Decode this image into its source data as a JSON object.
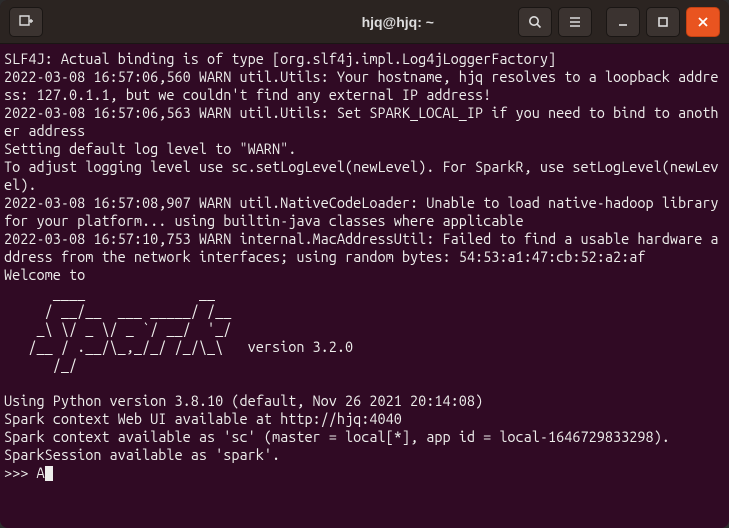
{
  "titlebar": {
    "title": "hjq@hjq: ~"
  },
  "terminal": {
    "lines": [
      "SLF4J: Actual binding is of type [org.slf4j.impl.Log4jLoggerFactory]",
      "2022-03-08 16:57:06,560 WARN util.Utils: Your hostname, hjq resolves to a loopback address: 127.0.1.1, but we couldn't find any external IP address!",
      "2022-03-08 16:57:06,563 WARN util.Utils: Set SPARK_LOCAL_IP if you need to bind to another address",
      "Setting default log level to \"WARN\".",
      "To adjust logging level use sc.setLogLevel(newLevel). For SparkR, use setLogLevel(newLevel).",
      "2022-03-08 16:57:08,907 WARN util.NativeCodeLoader: Unable to load native-hadoop library for your platform... using builtin-java classes where applicable",
      "2022-03-08 16:57:10,753 WARN internal.MacAddressUtil: Failed to find a usable hardware address from the network interfaces; using random bytes: 54:53:a1:47:cb:52:a2:af",
      "Welcome to"
    ],
    "ascii_art": "      ____              __\n     / __/__  ___ _____/ /__\n    _\\ \\/ _ \\/ _ `/ __/  '_/\n   /__ / .__/\\_,_/_/ /_/\\_\\   version 3.2.0\n      /_/",
    "lines2": [
      "",
      "Using Python version 3.8.10 (default, Nov 26 2021 20:14:08)",
      "Spark context Web UI available at http://hjq:4040",
      "Spark context available as 'sc' (master = local[*], app id = local-1646729833298).",
      "SparkSession available as 'spark'."
    ],
    "prompt": ">>> ",
    "input": "A"
  }
}
